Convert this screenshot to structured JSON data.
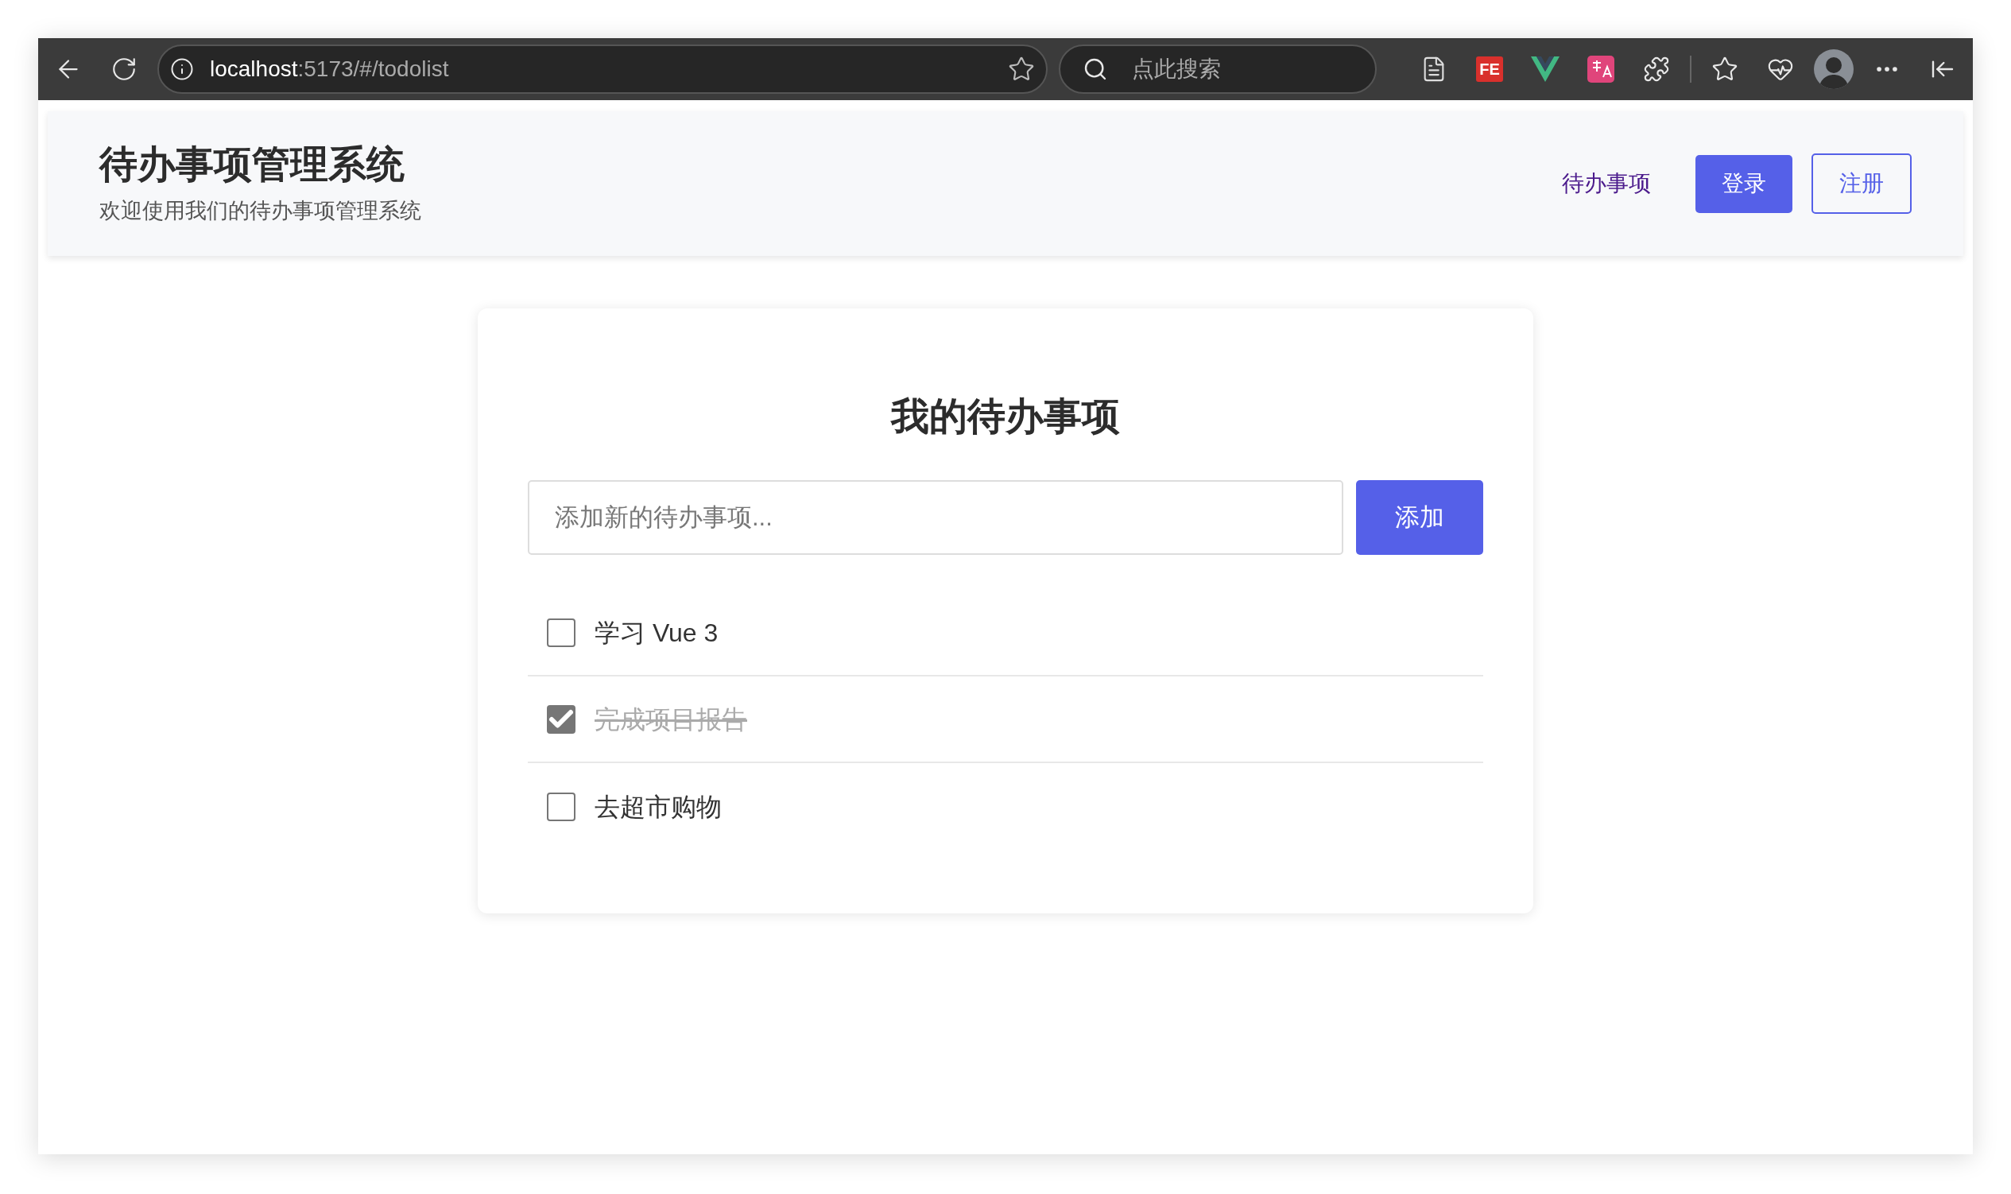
{
  "browser": {
    "url_host": "localhost",
    "url_path": ":5173/#/todolist",
    "search_placeholder": "点此搜索",
    "extension_label": "FE"
  },
  "header": {
    "title": "待办事项管理系统",
    "subtitle": "欢迎使用我们的待办事项管理系统",
    "nav_link": "待办事项",
    "login_button": "登录",
    "register_button": "注册"
  },
  "todo": {
    "title": "我的待办事项",
    "input_placeholder": "添加新的待办事项...",
    "add_button": "添加",
    "items": [
      {
        "text": "学习 Vue 3",
        "checked": false
      },
      {
        "text": "完成项目报告",
        "checked": true
      },
      {
        "text": "去超市购物",
        "checked": false
      }
    ]
  }
}
